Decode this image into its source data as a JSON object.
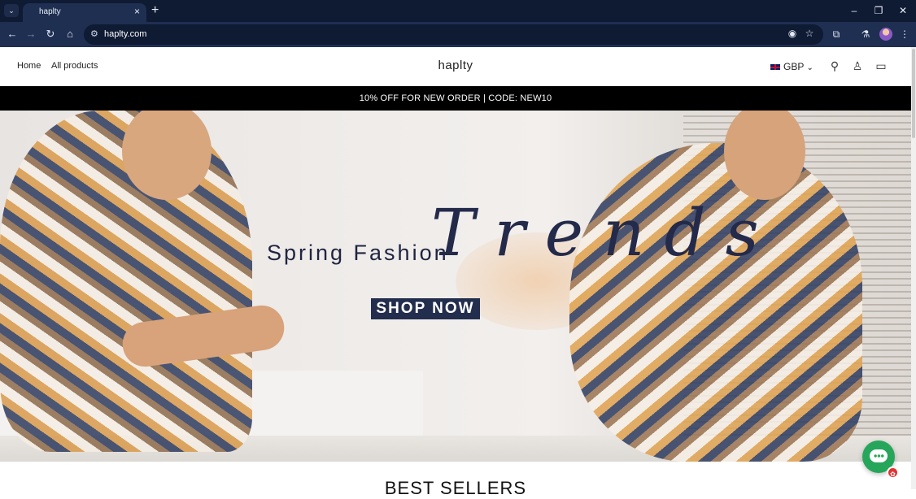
{
  "browser": {
    "tab_title": "haplty",
    "url": "haplty.com",
    "icons": [
      "tab-list-icon",
      "close-icon",
      "plus-icon",
      "minimize-icon",
      "restore-icon",
      "close-window-icon",
      "back-icon",
      "forward-icon",
      "reload-icon",
      "home-icon",
      "site-info-icon",
      "eye-off-icon",
      "star-icon",
      "extensions-icon",
      "labs-icon",
      "profile-avatar",
      "menu-icon"
    ]
  },
  "site": {
    "logo": "haplty",
    "nav": [
      {
        "label": "Home"
      },
      {
        "label": "All products"
      }
    ],
    "currency": "GBP",
    "announcement": "10% OFF FOR NEW ORDER | CODE: NEW10",
    "hero": {
      "subtitle": "Spring Fashion",
      "script": "Trends",
      "button": "SHOP NOW"
    },
    "section_title": "BEST SELLERS"
  },
  "colors": {
    "chrome_dark": "#0f1a33",
    "chrome_toolbar": "#1f2f52",
    "announcement_bg": "#000000",
    "hero_text": "#1f2440",
    "button_bg": "#232d4d",
    "chat_green": "#26a65b"
  }
}
